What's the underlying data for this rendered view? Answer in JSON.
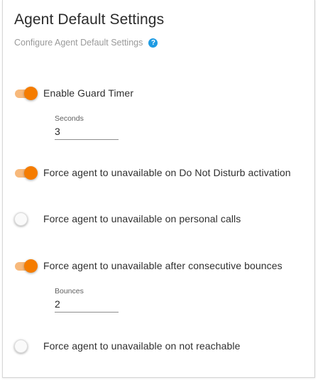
{
  "header": {
    "title": "Agent Default Settings",
    "subtitle": "Configure Agent Default Settings",
    "help_icon": "help-icon",
    "help_glyph": "?"
  },
  "colors": {
    "accent": "#f57c00",
    "accent_track": "#f7b97c",
    "help": "#1e9be3"
  },
  "settings": [
    {
      "label": "Enable Guard Timer",
      "enabled": true,
      "field": {
        "label": "Seconds",
        "value": "3"
      }
    },
    {
      "label": "Force agent to unavailable on Do Not Disturb activation",
      "enabled": true
    },
    {
      "label": "Force agent to unavailable on personal calls",
      "enabled": false
    },
    {
      "label": "Force agent to unavailable after consecutive bounces",
      "enabled": true,
      "field": {
        "label": "Bounces",
        "value": "2"
      }
    },
    {
      "label": "Force agent to unavailable on not reachable",
      "enabled": false
    }
  ]
}
